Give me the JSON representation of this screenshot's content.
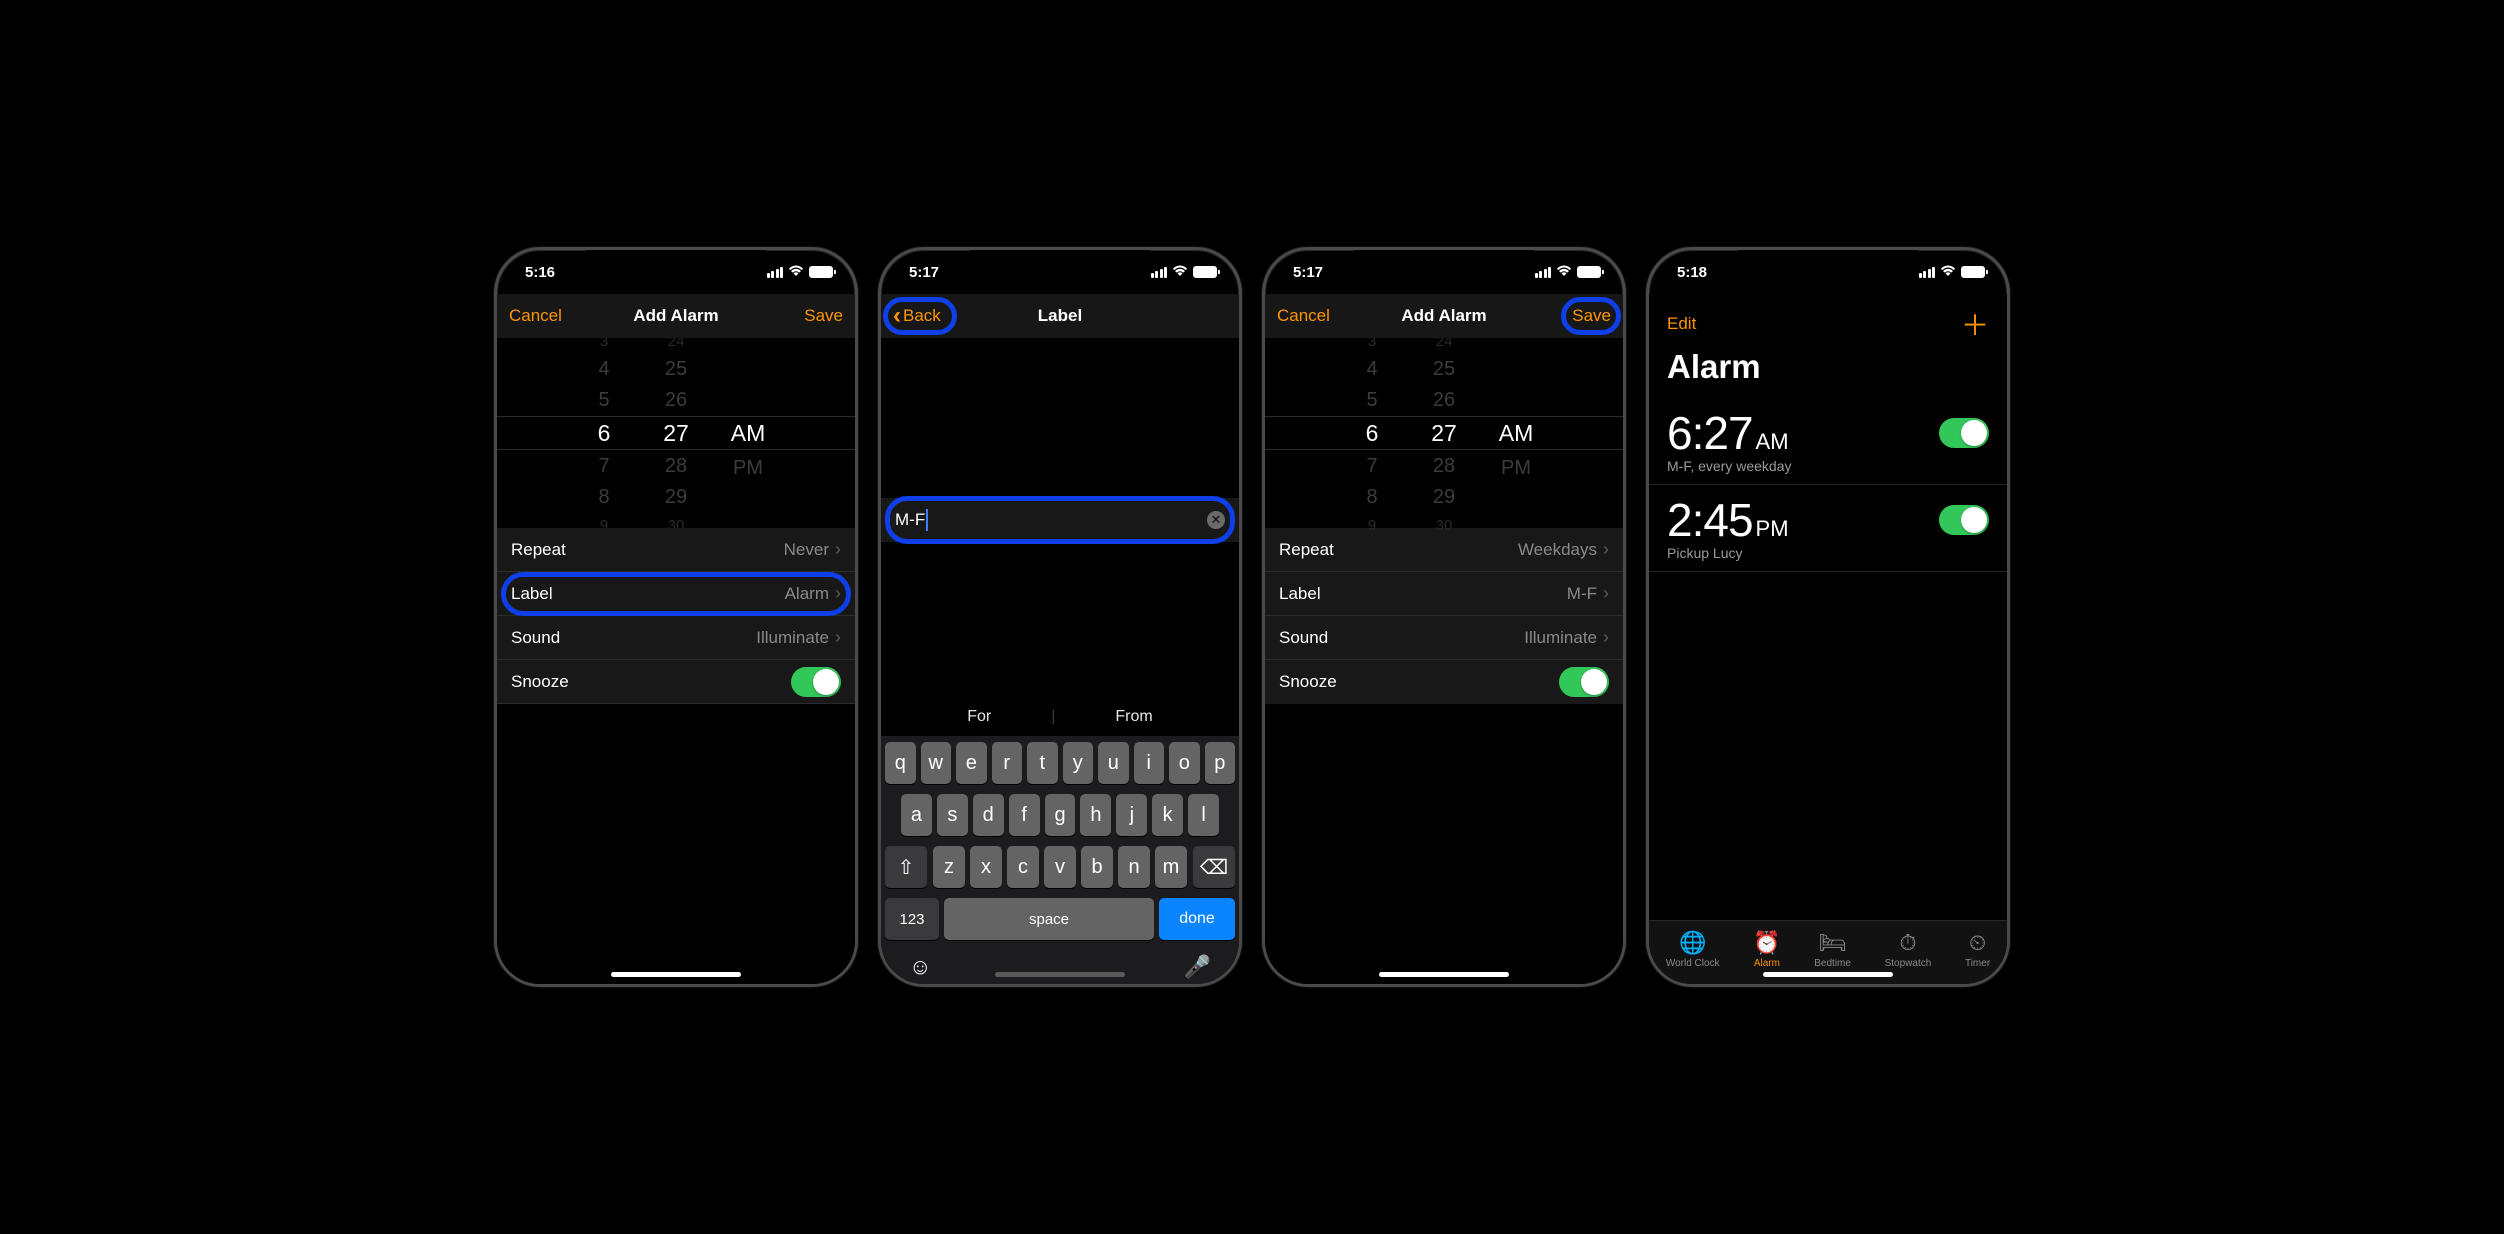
{
  "screen1": {
    "status_time": "5:16",
    "nav": {
      "left": "Cancel",
      "title": "Add Alarm",
      "right": "Save"
    },
    "picker": {
      "hour": {
        "faint_top": "3",
        "above2": "4",
        "above": "5",
        "current": "6",
        "below": "7",
        "below2": "8",
        "faint_bot": "9"
      },
      "min": {
        "faint_top": "24",
        "above2": "25",
        "above": "26",
        "current": "27",
        "below": "28",
        "below2": "29",
        "faint_bot": "30"
      },
      "ampm": {
        "current": "AM",
        "below": "PM"
      }
    },
    "rows": {
      "repeat": {
        "k": "Repeat",
        "v": "Never"
      },
      "label": {
        "k": "Label",
        "v": "Alarm"
      },
      "sound": {
        "k": "Sound",
        "v": "Illuminate"
      },
      "snooze": {
        "k": "Snooze"
      }
    }
  },
  "screen2": {
    "status_time": "5:17",
    "nav": {
      "back": "Back",
      "title": "Label"
    },
    "field_value": "M-F",
    "suggestions": {
      "a": "For",
      "b": "From"
    },
    "keys": {
      "r1": [
        "q",
        "w",
        "e",
        "r",
        "t",
        "y",
        "u",
        "i",
        "o",
        "p"
      ],
      "r2": [
        "a",
        "s",
        "d",
        "f",
        "g",
        "h",
        "j",
        "k",
        "l"
      ],
      "r3": [
        "z",
        "x",
        "c",
        "v",
        "b",
        "n",
        "m"
      ],
      "num": "123",
      "space": "space",
      "done": "done"
    }
  },
  "screen3": {
    "status_time": "5:17",
    "nav": {
      "left": "Cancel",
      "title": "Add Alarm",
      "right": "Save"
    },
    "rows": {
      "repeat": {
        "k": "Repeat",
        "v": "Weekdays"
      },
      "label": {
        "k": "Label",
        "v": "M-F"
      },
      "sound": {
        "k": "Sound",
        "v": "Illuminate"
      },
      "snooze": {
        "k": "Snooze"
      }
    }
  },
  "screen4": {
    "status_time": "5:18",
    "edit": "Edit",
    "title": "Alarm",
    "alarms": [
      {
        "time": "6:27",
        "ampm": "AM",
        "sub": "M-F, every weekday"
      },
      {
        "time": "2:45",
        "ampm": "PM",
        "sub": "Pickup Lucy"
      }
    ],
    "tabs": [
      "World Clock",
      "Alarm",
      "Bedtime",
      "Stopwatch",
      "Timer"
    ]
  }
}
